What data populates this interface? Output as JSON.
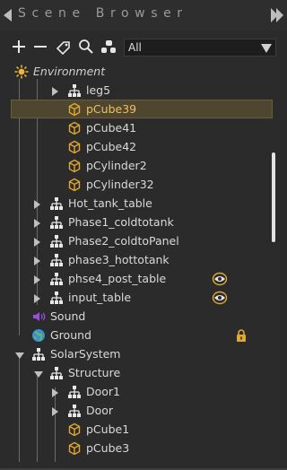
{
  "header": {
    "title": "Scene Browser",
    "collapse_icon": "triangle-left-icon",
    "expand_icon": "double-triangle-right-icon"
  },
  "toolbar": {
    "add_icon": "plus-icon",
    "remove_icon": "minus-icon",
    "tag_icon": "tag-icon",
    "search_icon": "search-icon",
    "hierarchy_icon": "hierarchy-icon",
    "filter_value": "All"
  },
  "tree": [
    {
      "id": "environment",
      "label": "Environment",
      "icon": "sun-icon",
      "italic": true
    },
    {
      "id": "leg5",
      "label": "leg5",
      "icon": "group-icon",
      "arrow": "right"
    },
    {
      "id": "pCube39",
      "label": "pCube39",
      "icon": "cube-icon",
      "selected": true
    },
    {
      "id": "pCube41",
      "label": "pCube41",
      "icon": "cube-icon"
    },
    {
      "id": "pCube42",
      "label": "pCube42",
      "icon": "cube-icon"
    },
    {
      "id": "pCylinder2",
      "label": "pCylinder2",
      "icon": "cube-icon"
    },
    {
      "id": "pCylinder32",
      "label": "pCylinder32",
      "icon": "cube-icon"
    },
    {
      "id": "hot_tank_table",
      "label": "Hot_tank_table",
      "icon": "group-icon",
      "arrow": "right"
    },
    {
      "id": "phase1",
      "label": "Phase1_coldtotank",
      "icon": "group-icon",
      "arrow": "right"
    },
    {
      "id": "phase2",
      "label": "Phase2_coldtoPanel",
      "icon": "group-icon",
      "arrow": "right"
    },
    {
      "id": "phase3",
      "label": "phase3_hottotank",
      "icon": "group-icon",
      "arrow": "right"
    },
    {
      "id": "phse4",
      "label": "phse4_post_table",
      "icon": "group-icon",
      "arrow": "right",
      "badge": "visibility-eye-icon"
    },
    {
      "id": "input_table",
      "label": "input_table",
      "icon": "group-icon",
      "arrow": "right",
      "badge": "visibility-eye-icon"
    },
    {
      "id": "sound",
      "label": "Sound",
      "icon": "speaker-icon"
    },
    {
      "id": "ground",
      "label": "Ground",
      "icon": "globe-icon",
      "badge": "lock-icon"
    },
    {
      "id": "solarsystem",
      "label": "SolarSystem",
      "icon": "group-icon",
      "arrow": "down"
    },
    {
      "id": "structure",
      "label": "Structure",
      "icon": "group-icon",
      "arrow": "down"
    },
    {
      "id": "door1",
      "label": "Door1",
      "icon": "group-icon",
      "arrow": "right"
    },
    {
      "id": "door",
      "label": "Door",
      "icon": "group-icon",
      "arrow": "right"
    },
    {
      "id": "pCube1",
      "label": "pCube1",
      "icon": "cube-icon"
    },
    {
      "id": "pCube3",
      "label": "pCube3",
      "icon": "cube-icon"
    }
  ],
  "colors": {
    "background": "#2b2b2b",
    "selection_fill": "#4f4630",
    "selection_text": "#f0c060",
    "accent_gold": "#e0a82e",
    "sound_icon": "#9a4fd8",
    "globe_icon": "#3b8fd6"
  }
}
